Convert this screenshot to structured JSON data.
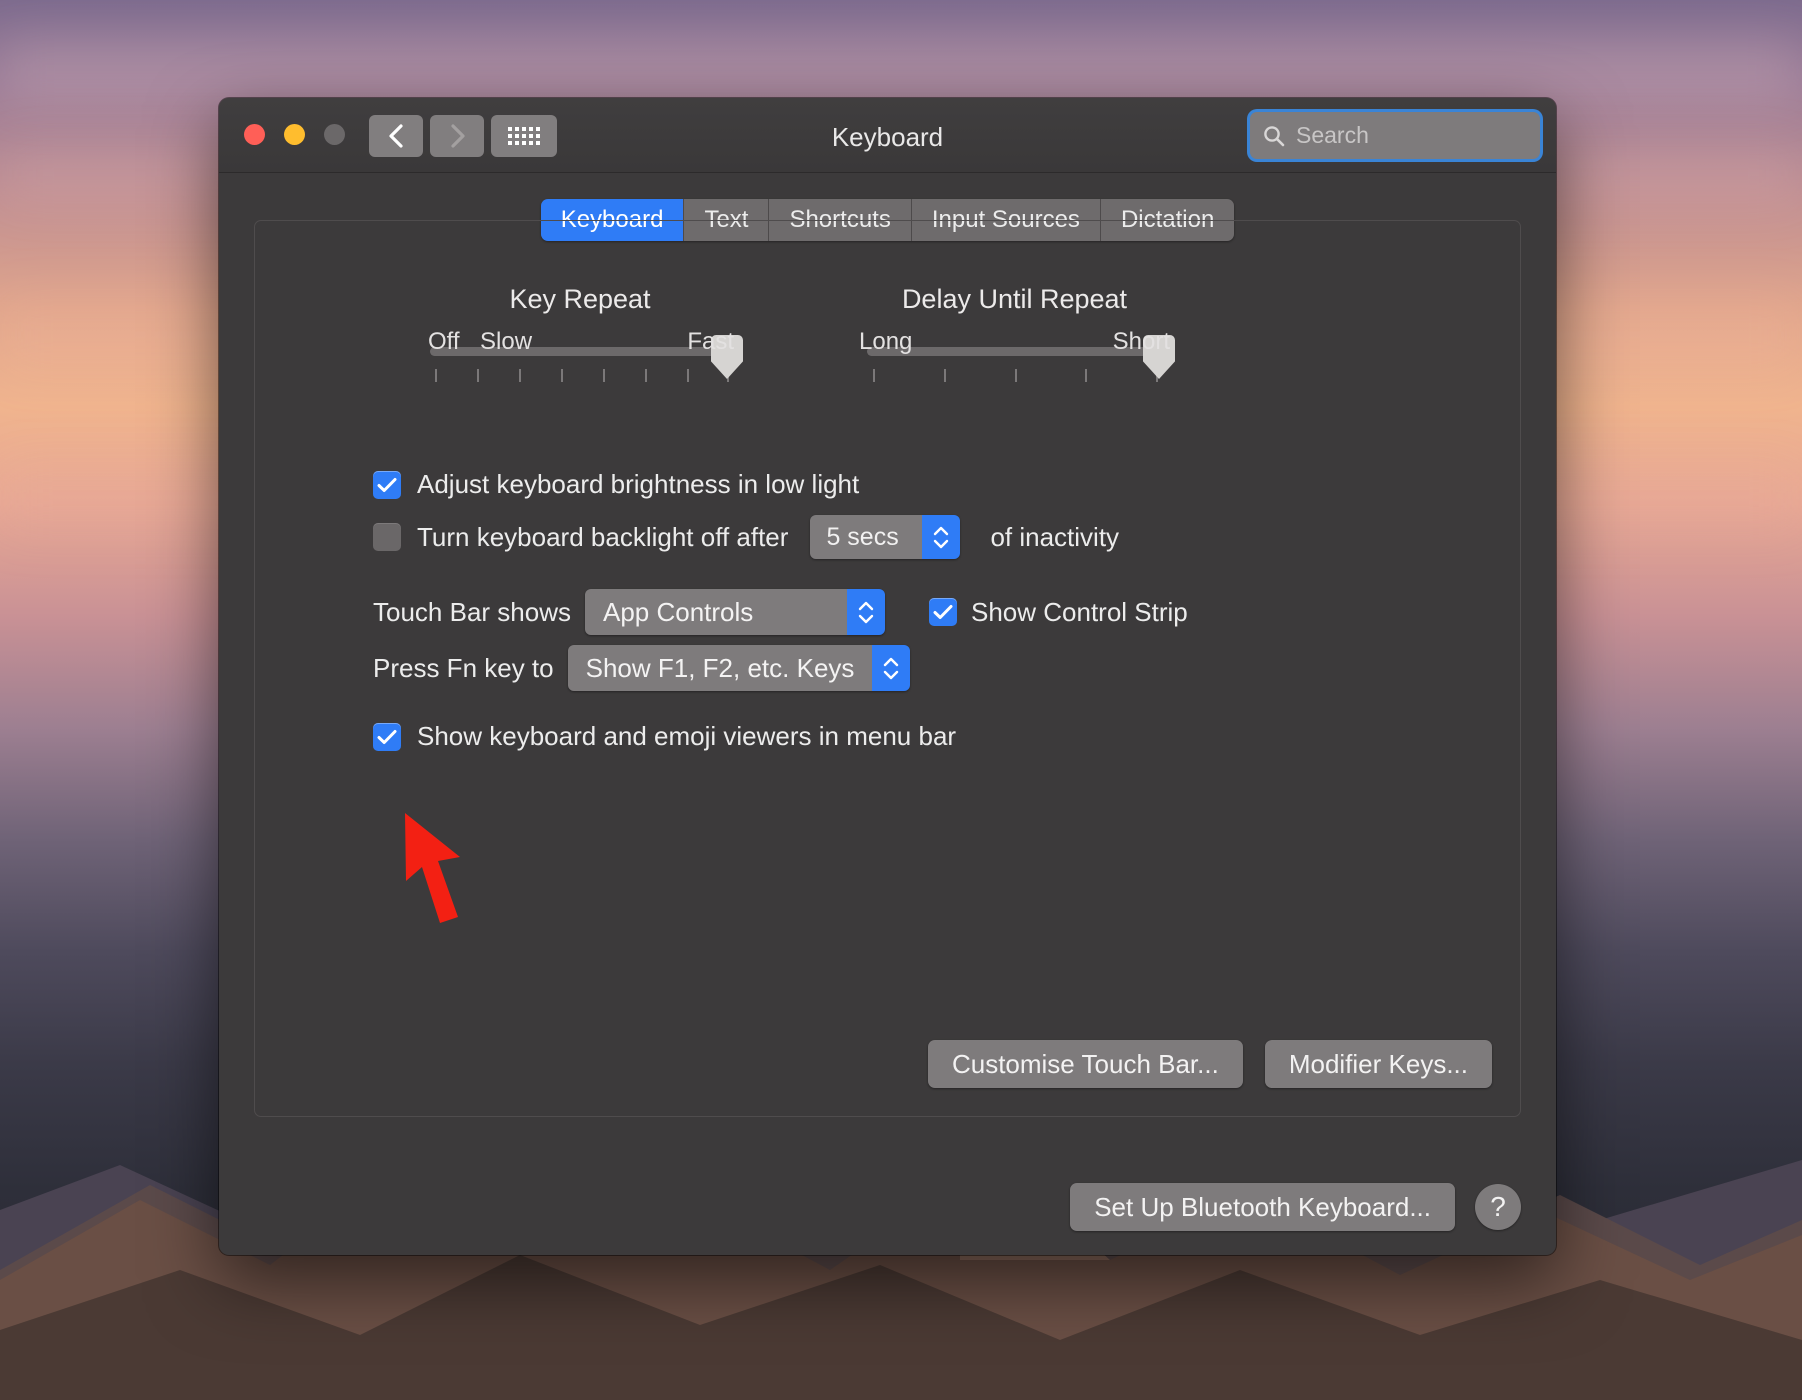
{
  "window": {
    "title": "Keyboard",
    "traffic_lights": [
      "close-button",
      "minimise-button",
      "zoom-button"
    ],
    "nav": {
      "back": "‹",
      "forward": "›",
      "show_all": "show-all-grid"
    },
    "search": {
      "placeholder": "Search",
      "value": ""
    }
  },
  "tabs": [
    {
      "label": "Keyboard",
      "active": true
    },
    {
      "label": "Text",
      "active": false
    },
    {
      "label": "Shortcuts",
      "active": false
    },
    {
      "label": "Input Sources",
      "active": false
    },
    {
      "label": "Dictation",
      "active": false
    }
  ],
  "sliders": [
    {
      "title": "Key Repeat",
      "labels": {
        "left": "Off",
        "left2": "Slow",
        "right": "Fast"
      },
      "ticks": 8,
      "value_pct": 100
    },
    {
      "title": "Delay Until Repeat",
      "labels": {
        "left": "Long",
        "right": "Short"
      },
      "ticks": 5,
      "value_pct": 100
    }
  ],
  "options": {
    "adjust_brightness": {
      "label": "Adjust keyboard brightness in low light",
      "checked": true
    },
    "backlight_off": {
      "label_before": "Turn keyboard backlight off after",
      "label_after": "of inactivity",
      "checked": false,
      "duration": "5 secs"
    },
    "touch_bar_shows": {
      "label": "Touch Bar shows",
      "value": "App Controls"
    },
    "show_control_strip": {
      "label": "Show Control Strip",
      "checked": true
    },
    "press_fn_key": {
      "label": "Press Fn key to",
      "value": "Show F1, F2, etc. Keys"
    },
    "show_viewers": {
      "label": "Show keyboard and emoji viewers in menu bar",
      "checked": true
    }
  },
  "buttons": {
    "customise_touch_bar": "Customise Touch Bar...",
    "modifier_keys": "Modifier Keys...",
    "set_up_bluetooth": "Set Up Bluetooth Keyboard...",
    "help": "?"
  },
  "annotation": {
    "type": "arrow",
    "colour": "#f32013",
    "points_to": "show-keyboard-emoji-viewers-checkbox"
  },
  "colours": {
    "accent": "#2f7cf6",
    "window_bg": "#3c3a3b",
    "control_bg": "#7e7b7c",
    "annotation_red": "#f32013"
  }
}
